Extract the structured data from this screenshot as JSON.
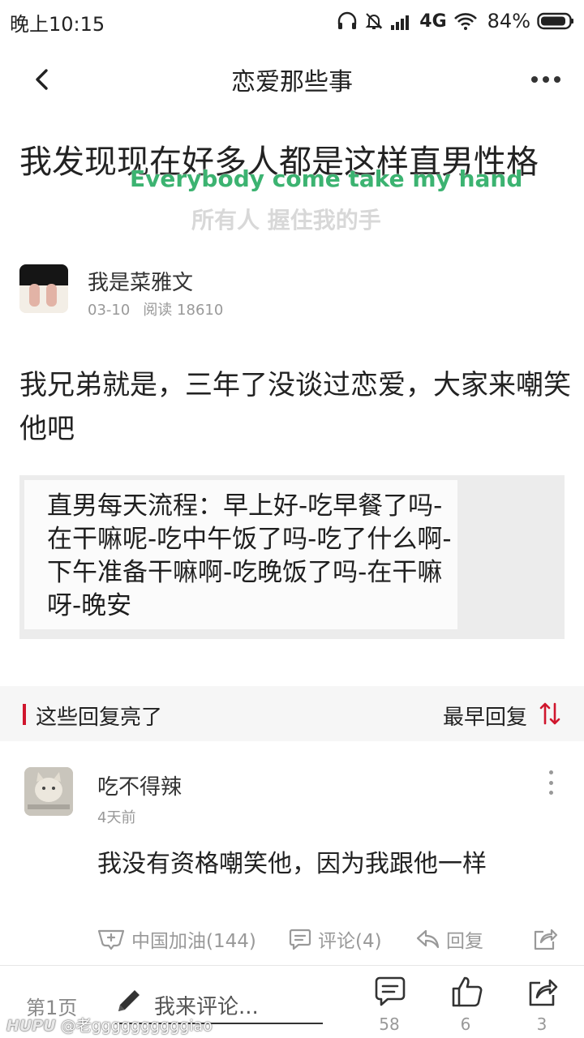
{
  "status_bar": {
    "time": "晚上10:15",
    "network": "4G",
    "battery": "84%"
  },
  "header": {
    "title": "恋爱那些事"
  },
  "post": {
    "title": "我发现现在好多人都是这样直男性格",
    "author": "我是菜雅文",
    "date": "03-10",
    "reads": "阅读 18610",
    "body": "我兄弟就是，三年了没谈过恋爱，大家来嘲笑他吧",
    "image_text": "直男每天流程：早上好-吃早餐了吗-在干嘛呢-吃中午饭了吗-吃了什么啊-下午准备干嘛啊-吃晚饭了吗-在干嘛呀-晚安"
  },
  "overlay": {
    "english": "Everybody come take my hand",
    "chinese": "所有人 握住我的手"
  },
  "replies_section": {
    "title": "这些回复亮了",
    "sort_label": "最早回复",
    "accent_color": "#d0162d"
  },
  "reply": {
    "author": "吃不得辣",
    "time": "4天前",
    "text": "我没有资格嘲笑他，因为我跟他一样",
    "like_label": "中国加油(144)",
    "comment_label": "评论(4)",
    "reply_label": "回复"
  },
  "bottom_bar": {
    "page": "第1页",
    "compose_placeholder": "我来评论...",
    "comment_count": "58",
    "like_count": "6",
    "share_count": "3"
  },
  "watermark": {
    "brand": "HUPU",
    "user": "@老ggggggggggiao"
  },
  "icons": [
    "headphones-icon",
    "mute-bell-icon",
    "signal-icon",
    "wifi-icon",
    "battery-icon",
    "back-arrow-icon",
    "more-icon",
    "sort-icon",
    "like-icon",
    "comment-icon",
    "reply-icon",
    "share-icon",
    "pencil-icon"
  ]
}
